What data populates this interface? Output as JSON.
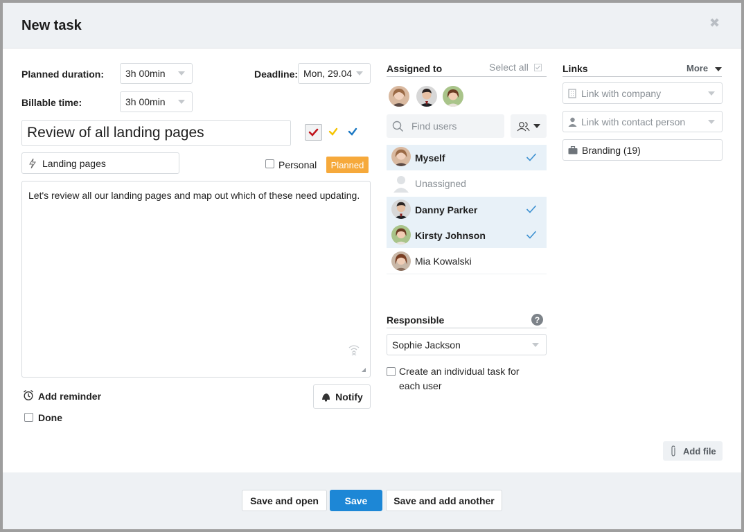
{
  "dialog": {
    "title": "New task"
  },
  "form": {
    "planned_duration_label": "Planned duration:",
    "planned_duration_value": "3h 00min",
    "billable_time_label": "Billable time:",
    "billable_time_value": "3h 00min",
    "deadline_label": "Deadline:",
    "deadline_value": "Mon, 29.04",
    "task_title": "Review of all landing pages",
    "project_value": "Landing pages",
    "personal_label": "Personal",
    "status_badge": "Planned",
    "description": "Let's review all our landing pages and map out which of these need updating.",
    "add_reminder_label": "Add reminder",
    "done_label": "Done",
    "notify_label": "Notify"
  },
  "priority_colors": {
    "red": "#c0141b",
    "yellow": "#f5c400",
    "blue": "#1d79c4"
  },
  "assigned": {
    "header": "Assigned to",
    "select_all": "Select all",
    "search_placeholder": "Find users",
    "users": [
      {
        "name": "Myself",
        "selected": true
      },
      {
        "name": "Unassigned",
        "selected": false
      },
      {
        "name": "Danny Parker",
        "selected": true
      },
      {
        "name": "Kirsty Johnson",
        "selected": true
      },
      {
        "name": "Mia Kowalski",
        "selected": false
      }
    ]
  },
  "responsible": {
    "header": "Responsible",
    "value": "Sophie Jackson",
    "individual_task_label": "Create an individual task for each user"
  },
  "links": {
    "header": "Links",
    "more_label": "More",
    "company_placeholder": "Link with company",
    "contact_placeholder": "Link with contact person",
    "project_value": "Branding (19)",
    "add_file_label": "Add file"
  },
  "footer": {
    "save_and_open": "Save and open",
    "save": "Save",
    "save_and_add_another": "Save and add another"
  },
  "colors": {
    "accent": "#1d87d6",
    "badge": "#f6a93b",
    "check": "#3a8fd0"
  }
}
